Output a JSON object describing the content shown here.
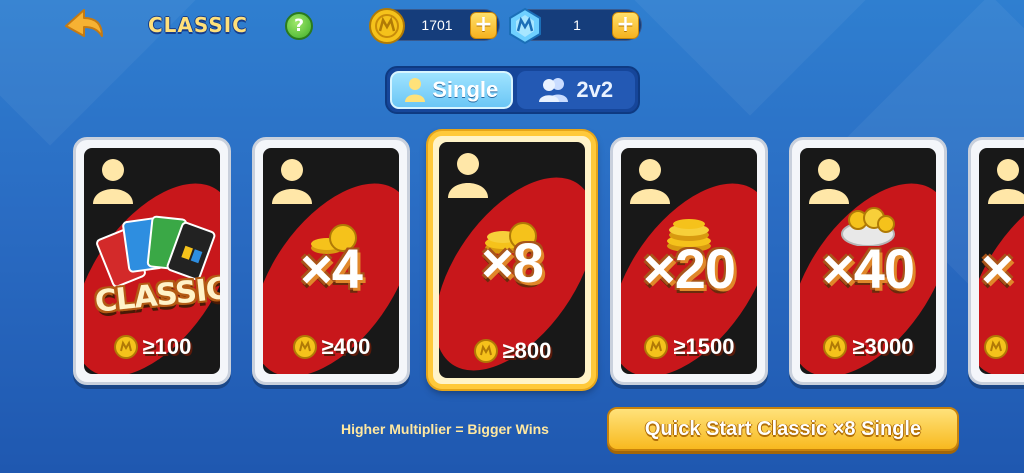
{
  "header": {
    "mode_title": "CLASSIC",
    "help_label": "?",
    "coins": {
      "value": "1701",
      "add_label": "+"
    },
    "gems": {
      "value": "1",
      "add_label": "+"
    }
  },
  "player_mode": {
    "options": [
      {
        "label": "Single",
        "selected": true
      },
      {
        "label": "2v2",
        "selected": false
      }
    ]
  },
  "tables": [
    {
      "multiplier": "",
      "art_label": "CLASSIC",
      "min_entry": "≥100",
      "selected": false
    },
    {
      "multiplier": "×4",
      "min_entry": "≥400",
      "selected": false
    },
    {
      "multiplier": "×8",
      "min_entry": "≥800",
      "selected": true
    },
    {
      "multiplier": "×20",
      "min_entry": "≥1500",
      "selected": false
    },
    {
      "multiplier": "×40",
      "min_entry": "≥3000",
      "selected": false
    },
    {
      "multiplier": "×",
      "min_entry": "",
      "selected": false
    }
  ],
  "footer": {
    "hint": "Higher Multiplier = Bigger Wins",
    "quick_start_label": "Quick Start Classic ×8 Single"
  },
  "colors": {
    "background": "#2a6cc3",
    "card_red": "#c8171b",
    "gold": "#f8b91f"
  }
}
